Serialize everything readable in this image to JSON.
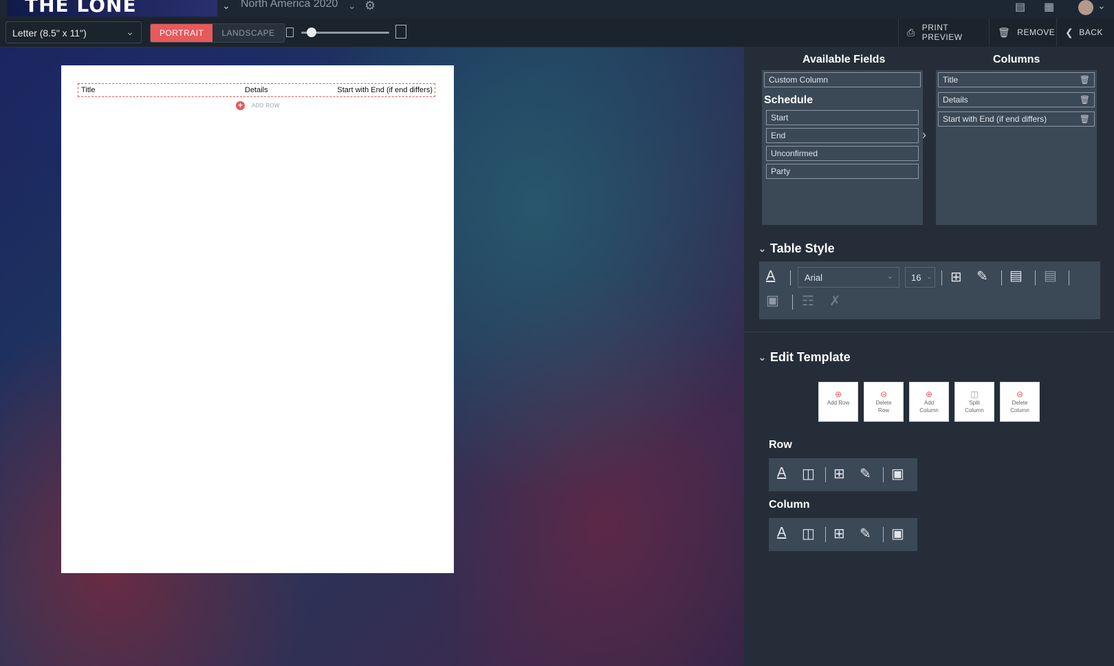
{
  "app": {
    "logo_text": "THE LONE RANGERS",
    "region": "North America 2020"
  },
  "toolbar": {
    "paper_size": "Letter (8.5\" x 11\")",
    "orientation_portrait": "PORTRAIT",
    "orientation_landscape": "LANDSCAPE",
    "selected_orientation": "PORTRAIT",
    "zoom_level": 0.12,
    "print_preview": "PRINT PREVIEW",
    "remove": "REMOVE",
    "back": "BACK"
  },
  "page_table": {
    "columns": [
      "Title",
      "Details",
      "Start with End (if end differs)"
    ],
    "add_row": "ADD ROW"
  },
  "fields_panel": {
    "available_title": "Available Fields",
    "columns_title": "Columns",
    "custom_column": "Custom Column",
    "group_name": "Schedule",
    "schedule_fields": [
      "Start",
      "End",
      "Unconfirmed",
      "Party"
    ],
    "selected_columns": [
      "Title",
      "Details",
      "Start with End (if end differs)"
    ]
  },
  "table_style": {
    "title": "Table Style",
    "font": "Arial",
    "size": "16"
  },
  "edit_template": {
    "title": "Edit Template",
    "actions": [
      {
        "line1": "Add Row",
        "line2": ""
      },
      {
        "line1": "Delete",
        "line2": "Row"
      },
      {
        "line1": "Add",
        "line2": "Column"
      },
      {
        "line1": "Split",
        "line2": "Column"
      },
      {
        "line1": "Delete",
        "line2": "Column"
      }
    ],
    "row_title": "Row",
    "column_title": "Column"
  },
  "colors": {
    "accent": "#e8595a",
    "panel": "#252e38",
    "field_box": "#3b4856"
  }
}
